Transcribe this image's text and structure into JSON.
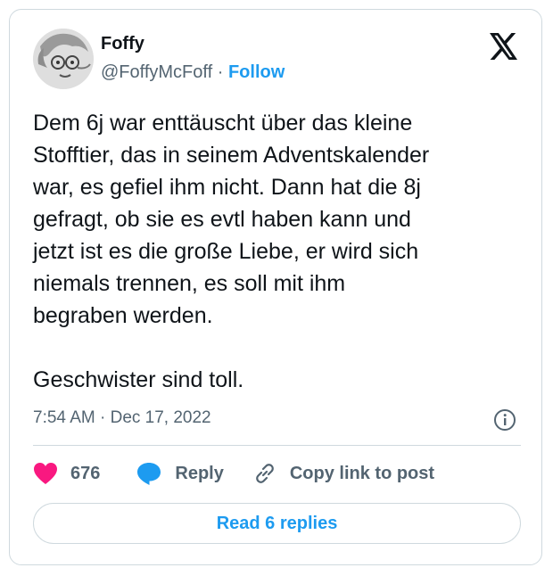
{
  "author": {
    "name": "Foffy",
    "handle": "@FoffyMcFoff",
    "separator": "·",
    "follow_label": "Follow"
  },
  "tweet": {
    "text": "Dem 6j war enttäuscht über das kleine\nStofftier, das in seinem Adventskalender\nwar, es gefiel ihm nicht. Dann hat die 8j\ngefragt, ob sie es evtl haben kann und\njetzt ist es die große Liebe, er wird sich\nniemals trennen, es soll mit ihm\nbegraben werden.\n\nGeschwister sind toll.",
    "timestamp": "7:54 AM · Dec 17, 2022"
  },
  "actions": {
    "like_count": "676",
    "reply_label": "Reply",
    "copy_label": "Copy link to post"
  },
  "read_replies_label": "Read 6 replies",
  "colors": {
    "accent": "#1d9bf0",
    "like": "#f91880",
    "text": "#0f1419",
    "muted": "#536471",
    "border": "#cfd9de"
  },
  "icons": [
    "x-logo-icon",
    "heart-icon",
    "reply-bubble-icon",
    "link-icon",
    "info-icon"
  ]
}
